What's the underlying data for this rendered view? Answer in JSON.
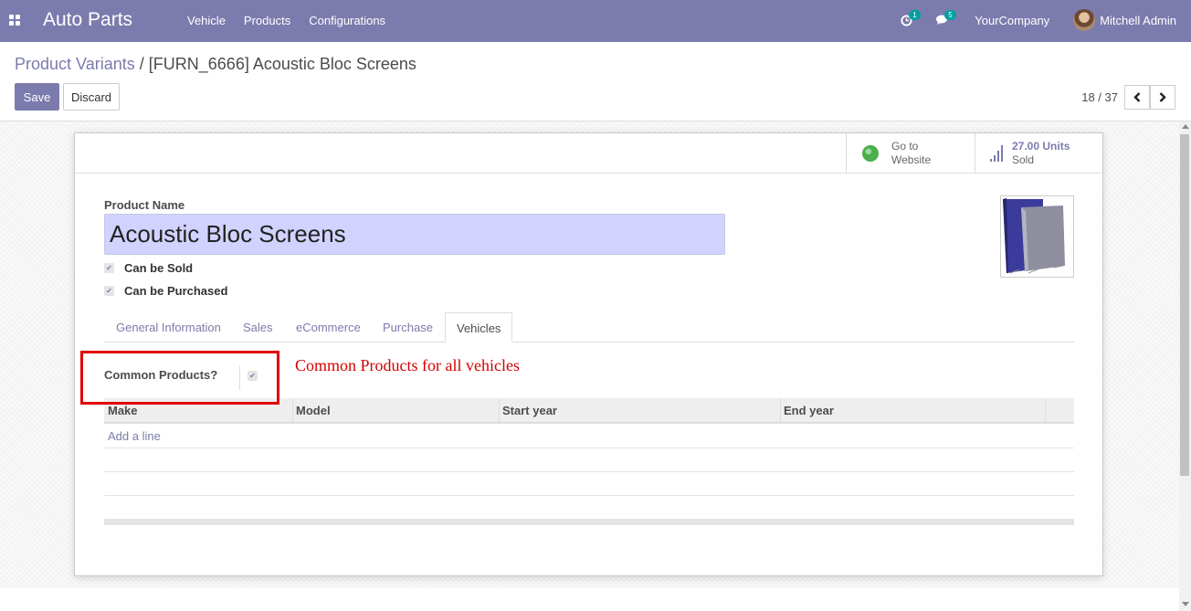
{
  "navbar": {
    "app_name": "Auto Parts",
    "menu": [
      "Vehicle",
      "Products",
      "Configurations"
    ],
    "activity_count": "1",
    "message_count": "5",
    "company": "YourCompany",
    "user": "Mitchell Admin"
  },
  "breadcrumb": {
    "parent": "Product Variants",
    "separator": "/",
    "current": "[FURN_6666] Acoustic Bloc Screens"
  },
  "buttons": {
    "save": "Save",
    "discard": "Discard"
  },
  "pager": {
    "value": "18 / 37"
  },
  "smart_buttons": {
    "website_line1": "Go to",
    "website_line2": "Website",
    "sold_value": "27.00 Units",
    "sold_label": "Sold"
  },
  "form": {
    "product_name_label": "Product Name",
    "product_name": "Acoustic Bloc Screens",
    "can_be_sold": "Can be Sold",
    "can_be_purchased": "Can be Purchased",
    "tabs": [
      "General Information",
      "Sales",
      "eCommerce",
      "Purchase",
      "Vehicles"
    ],
    "active_tab": "Vehicles",
    "common_products_label": "Common Products?",
    "common_products_checked": true
  },
  "annotation": "Common Products for all vehicles",
  "vehicle_table": {
    "columns": [
      "Make",
      "Model",
      "Start year",
      "End year"
    ],
    "add_line": "Add a line"
  },
  "colors": {
    "brand": "#7c7bad",
    "highlight": "#e00000",
    "name_field": "#d2d2ff"
  }
}
